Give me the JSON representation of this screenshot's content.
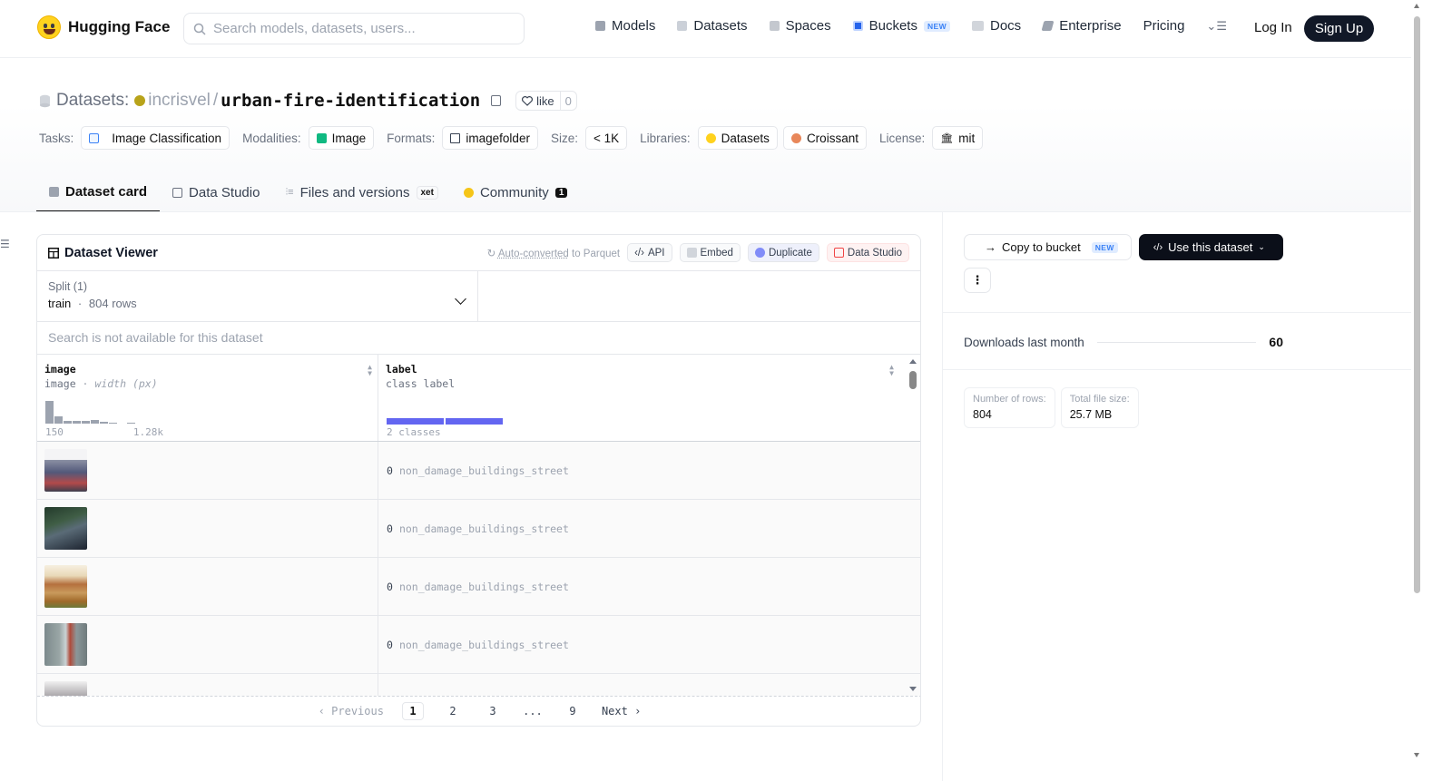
{
  "nav": {
    "brand": "Hugging Face",
    "search_placeholder": "Search models, datasets, users...",
    "links": [
      "Models",
      "Datasets",
      "Spaces",
      "Buckets",
      "Docs",
      "Enterprise",
      "Pricing"
    ],
    "new_badge": "NEW",
    "login": "Log In",
    "signup": "Sign Up"
  },
  "repo": {
    "section": "Datasets:",
    "owner": "incrisvel",
    "sep": "/",
    "name": "urban-fire-identification",
    "like_label": "like",
    "like_count": "0"
  },
  "tags": {
    "tasks_label": "Tasks:",
    "tasks_value": "Image Classification",
    "modalities_label": "Modalities:",
    "modalities_value": "Image",
    "formats_label": "Formats:",
    "formats_value": "imagefolder",
    "size_label": "Size:",
    "size_value": "< 1K",
    "libraries_label": "Libraries:",
    "libraries": [
      "Datasets",
      "Croissant"
    ],
    "license_label": "License:",
    "license_value": "mit"
  },
  "tabs": {
    "card": "Dataset card",
    "studio": "Data Studio",
    "files": "Files and versions",
    "xet": "xet",
    "community": "Community",
    "community_count": "1"
  },
  "viewer": {
    "title": "Dataset Viewer",
    "autoconv_link": "Auto-converted",
    "autoconv_rest": " to Parquet",
    "api": "API",
    "embed": "Embed",
    "duplicate": "Duplicate",
    "data_studio": "Data Studio",
    "split_label": "Split (1)",
    "split_value": "train",
    "split_dot": "·",
    "split_rows": "804 rows",
    "search_disabled": "Search is not available for this dataset",
    "col1_name": "image",
    "col1_type": "image",
    "col1_sep": " · ",
    "col1_stat": "width (px)",
    "col1_min": "150",
    "col1_max": "1.28k",
    "col2_name": "label",
    "col2_type": "class label",
    "col2_summary": "2 classes",
    "rows": [
      {
        "idx": "0",
        "label": "non_damage_buildings_street"
      },
      {
        "idx": "0",
        "label": "non_damage_buildings_street"
      },
      {
        "idx": "0",
        "label": "non_damage_buildings_street"
      },
      {
        "idx": "0",
        "label": "non_damage_buildings_street"
      },
      {
        "idx": "",
        "label": ""
      }
    ],
    "pager": {
      "prev": "Previous",
      "pages": [
        "1",
        "2",
        "3",
        "...",
        "9"
      ],
      "next": "Next"
    }
  },
  "side": {
    "copy_bucket": "Copy to bucket",
    "new_badge": "NEW",
    "use_dataset": "Use this dataset",
    "downloads_label": "Downloads last month",
    "downloads_value": "60",
    "rows_label": "Number of rows:",
    "rows_value": "804",
    "size_label": "Total file size:",
    "size_value": "25.7 MB"
  }
}
